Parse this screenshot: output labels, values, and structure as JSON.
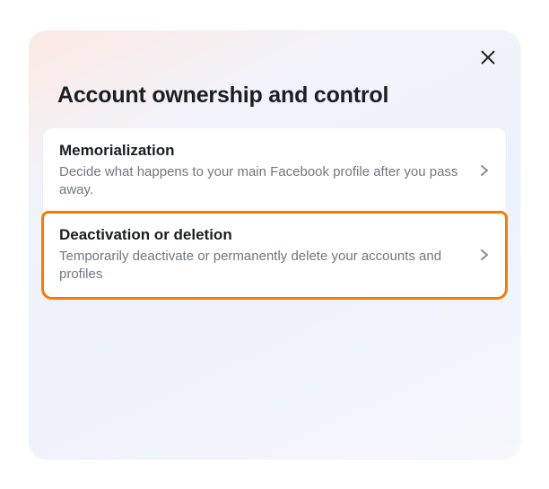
{
  "modal": {
    "title": "Account ownership and control",
    "items": [
      {
        "title": "Memorialization",
        "description": "Decide what happens to your main Facebook profile after you pass away."
      },
      {
        "title": "Deactivation or deletion",
        "description": "Temporarily deactivate or permanently delete your accounts and profiles"
      }
    ]
  },
  "highlight_color": "#f57c00"
}
